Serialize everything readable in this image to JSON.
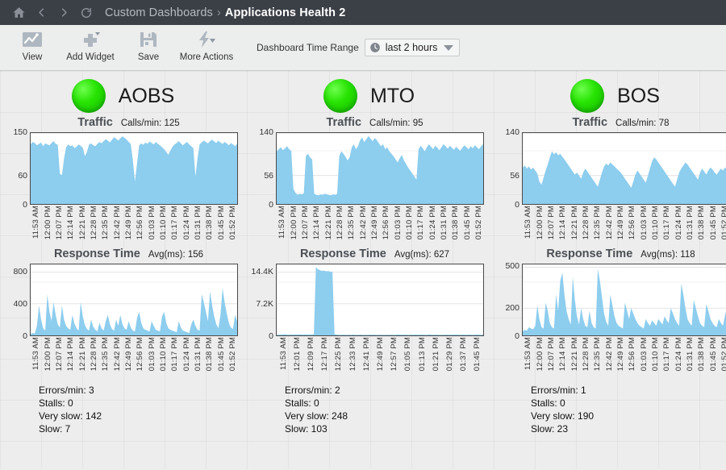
{
  "nav": {
    "icons": [
      "home-icon",
      "back-icon",
      "forward-icon",
      "refresh-icon"
    ],
    "breadcrumb_parent": "Custom Dashboards",
    "breadcrumb_separator": "›",
    "breadcrumb_current": "Applications Health 2"
  },
  "toolbar": {
    "items": [
      {
        "label": "View",
        "icon": "chart-line-icon"
      },
      {
        "label": "Add Widget",
        "icon": "plus-icon"
      },
      {
        "label": "Save",
        "icon": "floppy-disk-icon"
      },
      {
        "label": "More Actions",
        "icon": "lightning-bolt-icon"
      }
    ],
    "time_range_label": "Dashboard Time Range",
    "time_range_value": "last 2 hours",
    "time_range_icon": "clock-icon"
  },
  "colors": {
    "area_fill": "#8dcdee",
    "status_green": "#27e302",
    "navbar": "#3b3f46",
    "plot_border": "#4a4a4a"
  },
  "panels": [
    {
      "name": "AOBS",
      "status": "green",
      "traffic": {
        "title": "Traffic",
        "stat_label": "Calls/min:",
        "stat_value": "125"
      },
      "response": {
        "title": "Response Time",
        "stat_label": "Avg(ms):",
        "stat_value": "156"
      },
      "stats": [
        "Errors/min: 3",
        "Stalls: 0",
        "Very slow: 142",
        "Slow: 7"
      ]
    },
    {
      "name": "MTO",
      "status": "green",
      "traffic": {
        "title": "Traffic",
        "stat_label": "Calls/min:",
        "stat_value": "95"
      },
      "response": {
        "title": "Response Time",
        "stat_label": "Avg(ms):",
        "stat_value": "627"
      },
      "stats": [
        "Errors/min: 2",
        "Stalls: 0",
        "Very slow: 248",
        "Slow: 103"
      ]
    },
    {
      "name": "BOS",
      "status": "green",
      "traffic": {
        "title": "Traffic",
        "stat_label": "Calls/min:",
        "stat_value": "78"
      },
      "response": {
        "title": "Response Time",
        "stat_label": "Avg(ms):",
        "stat_value": "118"
      },
      "stats": [
        "Errors/min: 1",
        "Stalls: 0",
        "Very slow: 190",
        "Slow: 23"
      ]
    }
  ],
  "chart_data": [
    {
      "id": "aobs-traffic",
      "type": "area",
      "title": "Traffic",
      "panel": "AOBS",
      "ylabel": "",
      "xlabel": "",
      "ylim": [
        0,
        150
      ],
      "yticks": [
        0,
        60,
        150
      ],
      "ytick_labels": [
        "0",
        "60",
        "150"
      ],
      "grid": true,
      "xticks": [
        "11:53 AM",
        "12:00 PM",
        "12:07 PM",
        "12:14 PM",
        "12:21 PM",
        "12:28 PM",
        "12:35 PM",
        "12:42 PM",
        "12:49 PM",
        "12:56 PM",
        "01:03 PM",
        "01:10 PM",
        "01:17 PM",
        "01:24 PM",
        "01:31 PM",
        "01:38 PM",
        "01:45 PM",
        "01:52 PM"
      ],
      "values": [
        126,
        131,
        129,
        124,
        127,
        130,
        122,
        128,
        126,
        124,
        129,
        133,
        127,
        125,
        64,
        61,
        96,
        120,
        126,
        122,
        124,
        118,
        121,
        126,
        123,
        119,
        101,
        110,
        126,
        128,
        124,
        122,
        127,
        131,
        128,
        133,
        137,
        134,
        130,
        136,
        141,
        138,
        134,
        139,
        143,
        140,
        136,
        131,
        127,
        93,
        47,
        86,
        124,
        128,
        125,
        130,
        127,
        132,
        129,
        126,
        131,
        127,
        124,
        120,
        116,
        110,
        104,
        113,
        121,
        126,
        129,
        133,
        128,
        124,
        128,
        131,
        126,
        122,
        118,
        58,
        97,
        126,
        130,
        134,
        131,
        128,
        133,
        136,
        132,
        129,
        134,
        130,
        127,
        131,
        128,
        124,
        129,
        126,
        122,
        127
      ]
    },
    {
      "id": "mto-traffic",
      "type": "area",
      "title": "Traffic",
      "panel": "MTO",
      "ylim": [
        0,
        140
      ],
      "yticks": [
        0,
        56,
        140
      ],
      "ytick_labels": [
        "0",
        "56",
        "140"
      ],
      "grid": true,
      "xticks": [
        "11:53 AM",
        "12:00 PM",
        "12:07 PM",
        "12:14 PM",
        "12:21 PM",
        "12:28 PM",
        "12:35 PM",
        "12:42 PM",
        "12:49 PM",
        "12:56 PM",
        "01:03 PM",
        "01:10 PM",
        "01:17 PM",
        "01:24 PM",
        "01:31 PM",
        "01:38 PM",
        "01:45 PM",
        "01:52 PM"
      ],
      "values": [
        104,
        108,
        112,
        106,
        110,
        114,
        108,
        105,
        30,
        22,
        18,
        20,
        19,
        21,
        95,
        99,
        92,
        88,
        20,
        18,
        17,
        19,
        18,
        20,
        19,
        18,
        17,
        19,
        18,
        20,
        95,
        104,
        99,
        93,
        86,
        92,
        112,
        118,
        108,
        114,
        126,
        131,
        122,
        128,
        134,
        129,
        124,
        130,
        126,
        120,
        114,
        118,
        108,
        112,
        104,
        99,
        94,
        88,
        82,
        90,
        97,
        86,
        79,
        72,
        66,
        60,
        54,
        48,
        108,
        115,
        110,
        104,
        112,
        118,
        113,
        108,
        115,
        111,
        106,
        112,
        118,
        114,
        109,
        115,
        111,
        107,
        113,
        109,
        105,
        111,
        116,
        112,
        108,
        114,
        110,
        116,
        112,
        108,
        114,
        118
      ]
    },
    {
      "id": "bos-traffic",
      "type": "area",
      "title": "Traffic",
      "panel": "BOS",
      "ylim": [
        0,
        140
      ],
      "yticks": [
        0,
        56,
        140
      ],
      "ytick_labels": [
        "0",
        "56",
        "140"
      ],
      "grid": true,
      "xticks": [
        "11:53 AM",
        "12:00 PM",
        "12:07 PM",
        "12:14 PM",
        "12:21 PM",
        "12:28 PM",
        "12:35 PM",
        "12:42 PM",
        "12:49 PM",
        "12:56 PM",
        "01:03 PM",
        "01:10 PM",
        "01:17 PM",
        "01:24 PM",
        "01:31 PM",
        "01:38 PM",
        "01:45 PM",
        "01:52 PM"
      ],
      "values": [
        72,
        76,
        70,
        74,
        68,
        72,
        66,
        60,
        44,
        38,
        52,
        66,
        78,
        92,
        104,
        98,
        102,
        96,
        99,
        93,
        88,
        82,
        76,
        70,
        64,
        58,
        62,
        56,
        50,
        62,
        70,
        64,
        58,
        52,
        46,
        40,
        34,
        48,
        62,
        74,
        80,
        76,
        82,
        78,
        74,
        70,
        66,
        62,
        56,
        50,
        44,
        38,
        32,
        44,
        58,
        66,
        60,
        54,
        48,
        42,
        56,
        70,
        84,
        92,
        88,
        82,
        76,
        70,
        64,
        58,
        52,
        46,
        40,
        34,
        48,
        62,
        70,
        76,
        82,
        78,
        72,
        66,
        60,
        54,
        48,
        62,
        70,
        64,
        58,
        66,
        72,
        68,
        62,
        58,
        64,
        70,
        66,
        72,
        68,
        74
      ]
    },
    {
      "id": "aobs-response",
      "type": "area",
      "title": "Response Time",
      "panel": "AOBS",
      "ylim": [
        0,
        900
      ],
      "yticks": [
        0,
        400,
        800
      ],
      "ytick_labels": [
        "0",
        "400",
        "800"
      ],
      "grid": true,
      "xticks": [
        "11:53 AM",
        "12:00 PM",
        "12:07 PM",
        "12:14 PM",
        "12:21 PM",
        "12:28 PM",
        "12:35 PM",
        "12:42 PM",
        "12:49 PM",
        "12:56 PM",
        "01:03 PM",
        "01:10 PM",
        "01:17 PM",
        "01:24 PM",
        "01:31 PM",
        "01:38 PM",
        "01:45 PM",
        "01:52 PM"
      ],
      "values": [
        20,
        30,
        25,
        120,
        380,
        200,
        90,
        60,
        520,
        300,
        180,
        420,
        260,
        140,
        100,
        380,
        200,
        120,
        90,
        70,
        260,
        150,
        90,
        60,
        420,
        240,
        130,
        80,
        60,
        200,
        110,
        70,
        50,
        160,
        90,
        60,
        180,
        260,
        140,
        80,
        60,
        200,
        120,
        260,
        140,
        90,
        70,
        180,
        100,
        60,
        50,
        220,
        300,
        160,
        90,
        70,
        60,
        50,
        180,
        120,
        70,
        60,
        50,
        240,
        300,
        160,
        90,
        70,
        60,
        50,
        40,
        180,
        100,
        60,
        50,
        40,
        30,
        140,
        200,
        120,
        70,
        60,
        520,
        420,
        300,
        180,
        560,
        380,
        240,
        140,
        90,
        260,
        600,
        420,
        280,
        160,
        100,
        80,
        260,
        180
      ]
    },
    {
      "id": "mto-response",
      "type": "area",
      "title": "Response Time",
      "panel": "MTO",
      "ylim": [
        0,
        16200
      ],
      "yticks": [
        0,
        7200,
        14400
      ],
      "ytick_labels": [
        "0",
        "7.2K",
        "14.4K"
      ],
      "grid": true,
      "xticks": [
        "11:53 AM",
        "12:01 PM",
        "12:09 PM",
        "12:17 PM",
        "12:25 PM",
        "12:33 PM",
        "12:41 PM",
        "12:49 PM",
        "12:57 PM",
        "01:05 PM",
        "01:13 PM",
        "01:21 PM",
        "01:29 PM",
        "01:37 PM",
        "01:45 PM"
      ],
      "values": [
        120,
        180,
        150,
        200,
        260,
        180,
        140,
        200,
        160,
        220,
        180,
        240,
        200,
        160,
        220,
        180,
        150,
        240,
        200,
        15600,
        15100,
        14900,
        14700,
        14800,
        14600,
        14700,
        14500,
        14600,
        300,
        180,
        140,
        120,
        160,
        130,
        110,
        150,
        120,
        180,
        140,
        110,
        160,
        130,
        100,
        140,
        120,
        160,
        130,
        180,
        140,
        110,
        160,
        130,
        100,
        150,
        120,
        170,
        140,
        110,
        160,
        200,
        170,
        140,
        180,
        150,
        120,
        170,
        140,
        190,
        160,
        130,
        180,
        150,
        120,
        170,
        200,
        160,
        130,
        180,
        150,
        120,
        170,
        140,
        190,
        160,
        130,
        180,
        150,
        200,
        170,
        140,
        190,
        160,
        130,
        180,
        150,
        120,
        170,
        200,
        160,
        130,
        180
      ]
    },
    {
      "id": "bos-response",
      "type": "area",
      "title": "Response Time",
      "panel": "BOS",
      "ylim": [
        0,
        520
      ],
      "yticks": [
        0,
        200,
        500
      ],
      "ytick_labels": [
        "0",
        "200",
        "500"
      ],
      "grid": true,
      "xticks": [
        "11:53 AM",
        "12:00 PM",
        "12:07 PM",
        "12:14 PM",
        "12:21 PM",
        "12:28 PM",
        "12:35 PM",
        "12:42 PM",
        "12:49 PM",
        "12:56 PM",
        "01:03 PM",
        "01:10 PM",
        "01:17 PM",
        "01:24 PM",
        "01:31 PM",
        "01:38 PM",
        "01:45 PM",
        "01:52 PM"
      ],
      "values": [
        30,
        40,
        35,
        60,
        50,
        45,
        70,
        220,
        120,
        60,
        50,
        240,
        180,
        90,
        60,
        50,
        300,
        180,
        400,
        460,
        300,
        180,
        120,
        80,
        430,
        260,
        140,
        80,
        200,
        120,
        70,
        60,
        180,
        90,
        60,
        50,
        490,
        400,
        280,
        160,
        100,
        70,
        300,
        220,
        140,
        90,
        70,
        60,
        50,
        240,
        180,
        120,
        200,
        160,
        120,
        90,
        70,
        60,
        50,
        120,
        90,
        70,
        110,
        90,
        70,
        120,
        100,
        80,
        140,
        110,
        90,
        200,
        160,
        120,
        90,
        70,
        380,
        300,
        200,
        120,
        90,
        70,
        260,
        200,
        140,
        90,
        70,
        60,
        230,
        180,
        120,
        90,
        70,
        60,
        120,
        90,
        70,
        150,
        200,
        260
      ]
    }
  ]
}
